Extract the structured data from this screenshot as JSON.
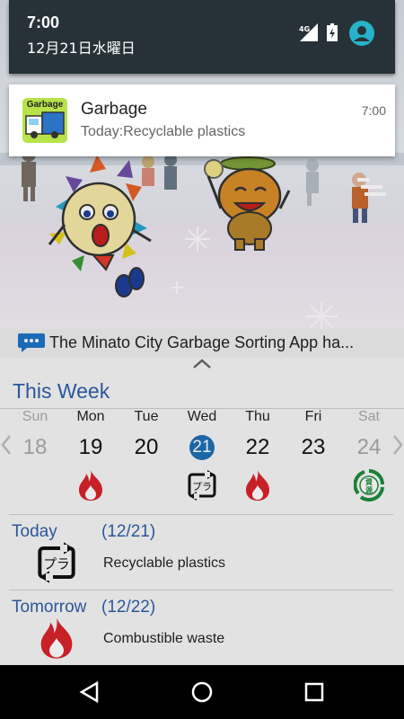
{
  "status": {
    "time": "7:00",
    "date": "12月21日水曜日",
    "network": "4G"
  },
  "notification": {
    "app_icon_text": "Garbage",
    "title": "Garbage",
    "body": "Today:Recyclable plastics",
    "time": "7:00"
  },
  "news": {
    "text": "The Minato City Garbage Sorting App ha..."
  },
  "week": {
    "title": "This Week",
    "days": [
      {
        "name": "Sun",
        "num": "18",
        "icon": "none"
      },
      {
        "name": "Mon",
        "num": "19",
        "icon": "flame-icon"
      },
      {
        "name": "Tue",
        "num": "20",
        "icon": "none"
      },
      {
        "name": "Wed",
        "num": "21",
        "icon": "recyclable-plastics-icon"
      },
      {
        "name": "Thu",
        "num": "22",
        "icon": "flame-icon"
      },
      {
        "name": "Fri",
        "num": "23",
        "icon": "none"
      },
      {
        "name": "Sat",
        "num": "24",
        "icon": "resources-icon"
      }
    ]
  },
  "today": {
    "label": "Today",
    "date": "(12/21)",
    "item": "Recyclable plastics",
    "icon": "recyclable-plastics-icon"
  },
  "tomorrow": {
    "label": "Tomorrow",
    "date": "(12/22)",
    "item": "Combustible waste",
    "icon": "flame-icon"
  },
  "colors": {
    "accent_blue": "#2e5fa8",
    "shade_bg": "#263238",
    "flame_red": "#d8232a",
    "resource_green": "#1c8b3a",
    "today_circle": "#1f6fb5"
  }
}
